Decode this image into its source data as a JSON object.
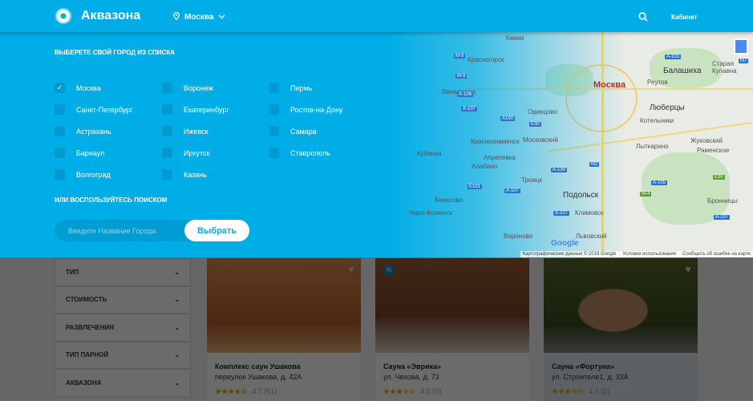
{
  "header": {
    "brand": "Аквазона",
    "city": "Москва",
    "cabinet": "Кабинет"
  },
  "picker": {
    "list_heading": "ВЫБЕРЕТЕ СВОЙ ГОРОД ИЗ СПИСКА",
    "cities": [
      {
        "name": "Москва",
        "checked": true
      },
      {
        "name": "Санкт-Петербург"
      },
      {
        "name": "Астрахань"
      },
      {
        "name": "Барнаул"
      },
      {
        "name": "Волгоград"
      },
      {
        "name": "Воронеж"
      },
      {
        "name": "Екатеринбург"
      },
      {
        "name": "Ижевск"
      },
      {
        "name": "Иркутск"
      },
      {
        "name": "Казань"
      },
      {
        "name": "Пермь"
      },
      {
        "name": "Ростов-на-Дону"
      },
      {
        "name": "Самара"
      },
      {
        "name": "Ставрополь"
      }
    ],
    "search_heading": "ИЛИ ВОСПОЛЬЗУЙТЕСЬ ПОИСКОМ",
    "search_placeholder": "Введите Название Города",
    "submit": "Выбрать"
  },
  "map": {
    "labels": [
      "Химки",
      "Красногорск",
      "Москва",
      "Балашиха",
      "Реутов",
      "Люберцы",
      "Котельники",
      "Одинцово",
      "Московский",
      "Краснознаменск",
      "Лыткарино",
      "Жуковский",
      "Раменское",
      "Апрелевка",
      "Алабино",
      "Троицк",
      "Подольск",
      "Климовск",
      "Львовский",
      "Бекасово",
      "Наро-Фоминск",
      "Кубинка",
      "Звенигород",
      "Старая Купавна",
      "Вороново",
      "Бронницы"
    ],
    "highways": [
      "M-9",
      "M-9",
      "A-106",
      "A-107",
      "A100",
      "E30",
      "A-103",
      "M7",
      "A-130",
      "M2",
      "E101",
      "A-107",
      "A-105",
      "M-4",
      "E30",
      "A-107",
      "A-107"
    ],
    "logo": "Google",
    "copyright": "Картографические данные © 2019 Google",
    "terms": "Условия использования",
    "report": "Сообщить об ошибке на карте"
  },
  "filters": [
    "ТИП",
    "СТОИМОСТЬ",
    "РАЗВЛЕЧЕНИЯ",
    "ТИП ПАРНОЙ",
    "АКВАЗОНА"
  ],
  "cards": [
    {
      "title": "Комплекс саун Ушакова",
      "address": "переулок Ушакова, д. 42А",
      "stars": "★★★★☆",
      "rating": "4.7 (51)"
    },
    {
      "title": "Сауна «Эврика»",
      "address": "ул. Чехова, д. 73",
      "stars": "★★★☆☆",
      "rating": "4.5 (0)",
      "badge": "%"
    },
    {
      "title": "Сауна «Фортуна»",
      "address": "ул. Строителе1, д. 33А",
      "stars": "★★★☆☆",
      "rating": "4.5 (0)"
    }
  ]
}
